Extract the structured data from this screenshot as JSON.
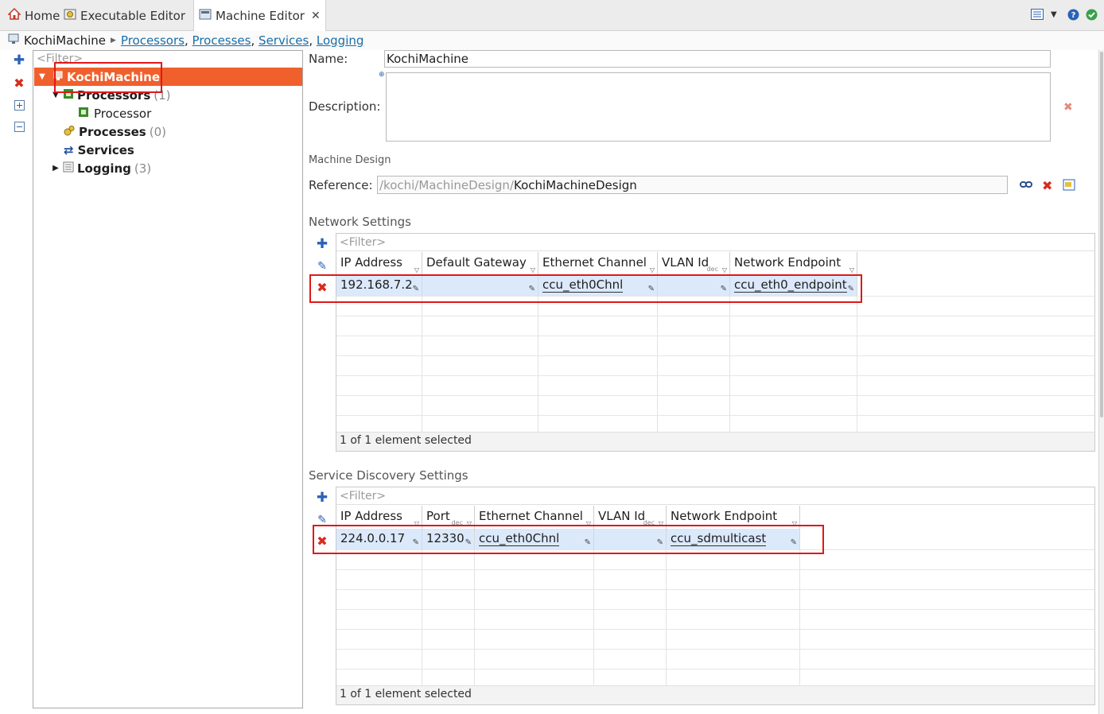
{
  "tabs": [
    {
      "label": "Home",
      "icon": "home-icon"
    },
    {
      "label": "Executable Editor",
      "icon": "executable-icon"
    },
    {
      "label": "Machine Editor",
      "icon": "machine-icon",
      "active": true
    }
  ],
  "breadcrumb": {
    "root": "KochiMachine",
    "links": [
      "Processors",
      "Processes",
      "Services",
      "Logging"
    ],
    "separator": ","
  },
  "tree": {
    "filter_placeholder": "<Filter>",
    "root": {
      "label": "KochiMachine"
    },
    "items": [
      {
        "label": "Processors",
        "count": "(1)"
      },
      {
        "label": "Processor"
      },
      {
        "label": "Processes",
        "count": "(0)"
      },
      {
        "label": "Services"
      },
      {
        "label": "Logging",
        "count": "(3)"
      }
    ]
  },
  "form": {
    "name_label": "Name:",
    "name_value": "KochiMachine",
    "description_label": "Description:",
    "description_value": "",
    "machine_design_title": "Machine Design",
    "reference_label": "Reference:",
    "reference_path": "/kochi/MachineDesign/",
    "reference_name": "KochiMachineDesign"
  },
  "network": {
    "title": "Network Settings",
    "filter_placeholder": "<Filter>",
    "columns": [
      "IP Address",
      "Default Gateway",
      "Ethernet Channel",
      "VLAN Id",
      "Network Endpoint"
    ],
    "dec_label": "dec",
    "row": {
      "ip": "192.168.7.2",
      "gateway": "",
      "channel": "ccu_eth0Chnl",
      "vlan": "",
      "endpoint": "ccu_eth0_endpoint"
    },
    "status": "1 of 1 element selected"
  },
  "discovery": {
    "title": "Service Discovery Settings",
    "filter_placeholder": "<Filter>",
    "columns": [
      "IP Address",
      "Port",
      "Ethernet Channel",
      "VLAN Id",
      "Network Endpoint"
    ],
    "dec_label": "dec",
    "row": {
      "ip": "224.0.0.17",
      "port": "12330",
      "channel": "ccu_eth0Chnl",
      "vlan": "",
      "endpoint": "ccu_sdmulticast"
    },
    "status": "1 of 1 element selected"
  },
  "colors": {
    "selection": "#f0602c",
    "row_highlight": "#dbe9fb",
    "annotation": "#e01818",
    "link": "#1a6ea8"
  }
}
